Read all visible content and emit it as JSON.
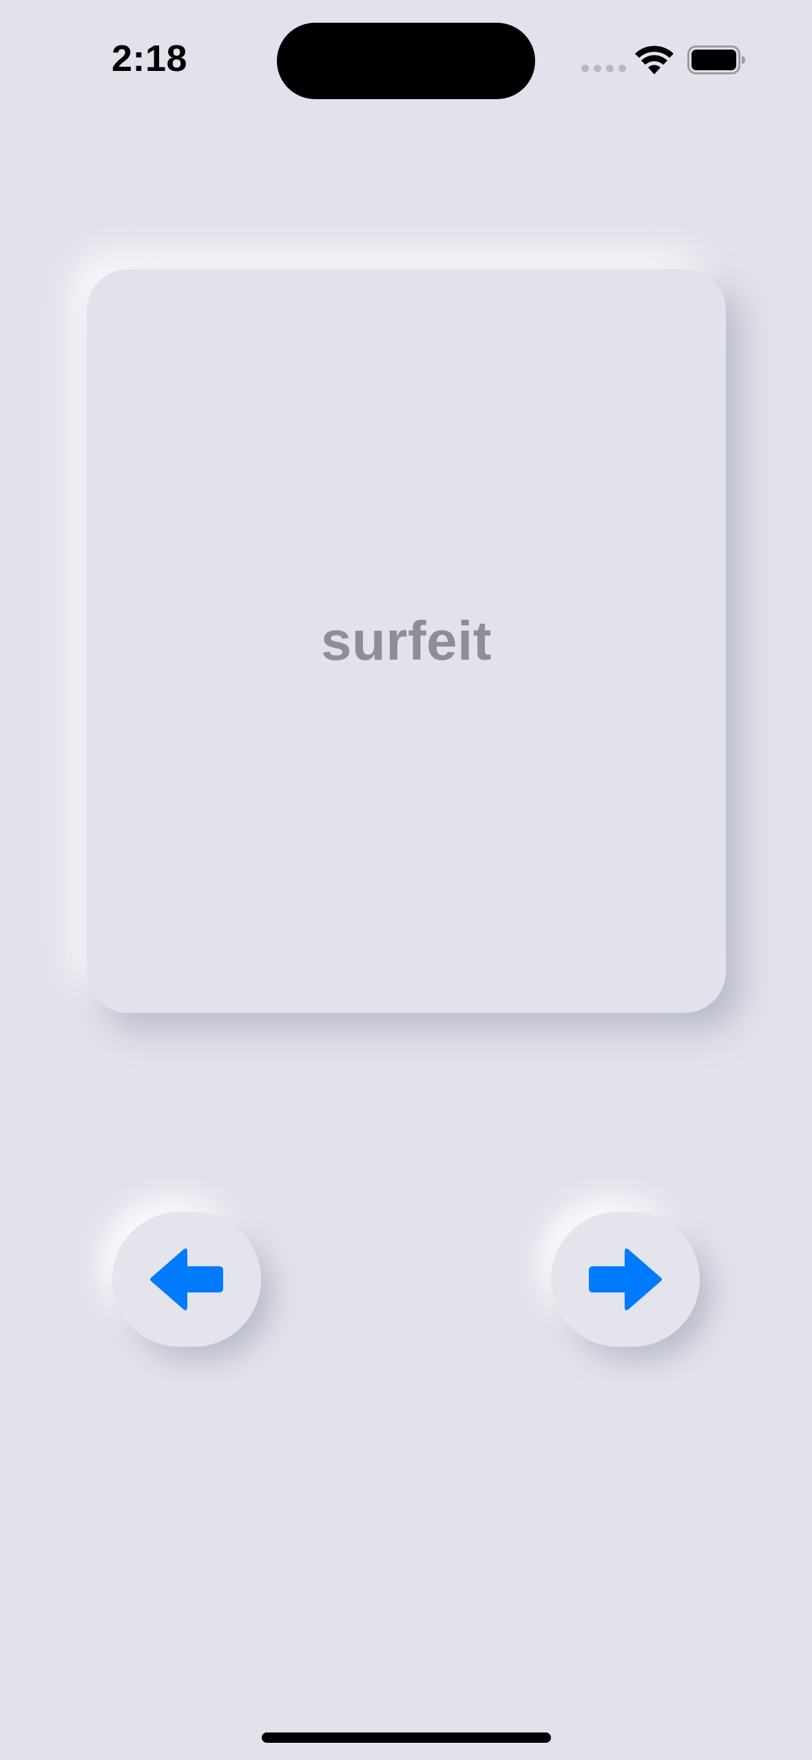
{
  "status_bar": {
    "time": "2:18",
    "icons": [
      "cellular-signal-icon",
      "wifi-icon",
      "battery-icon"
    ]
  },
  "card": {
    "word": "surfeit"
  },
  "navigation": {
    "previous_icon": "arrow-left-icon",
    "next_icon": "arrow-right-icon"
  },
  "colors": {
    "background": "#e1e2eb",
    "accent": "#007aff",
    "card_text": "#8e8e96"
  }
}
